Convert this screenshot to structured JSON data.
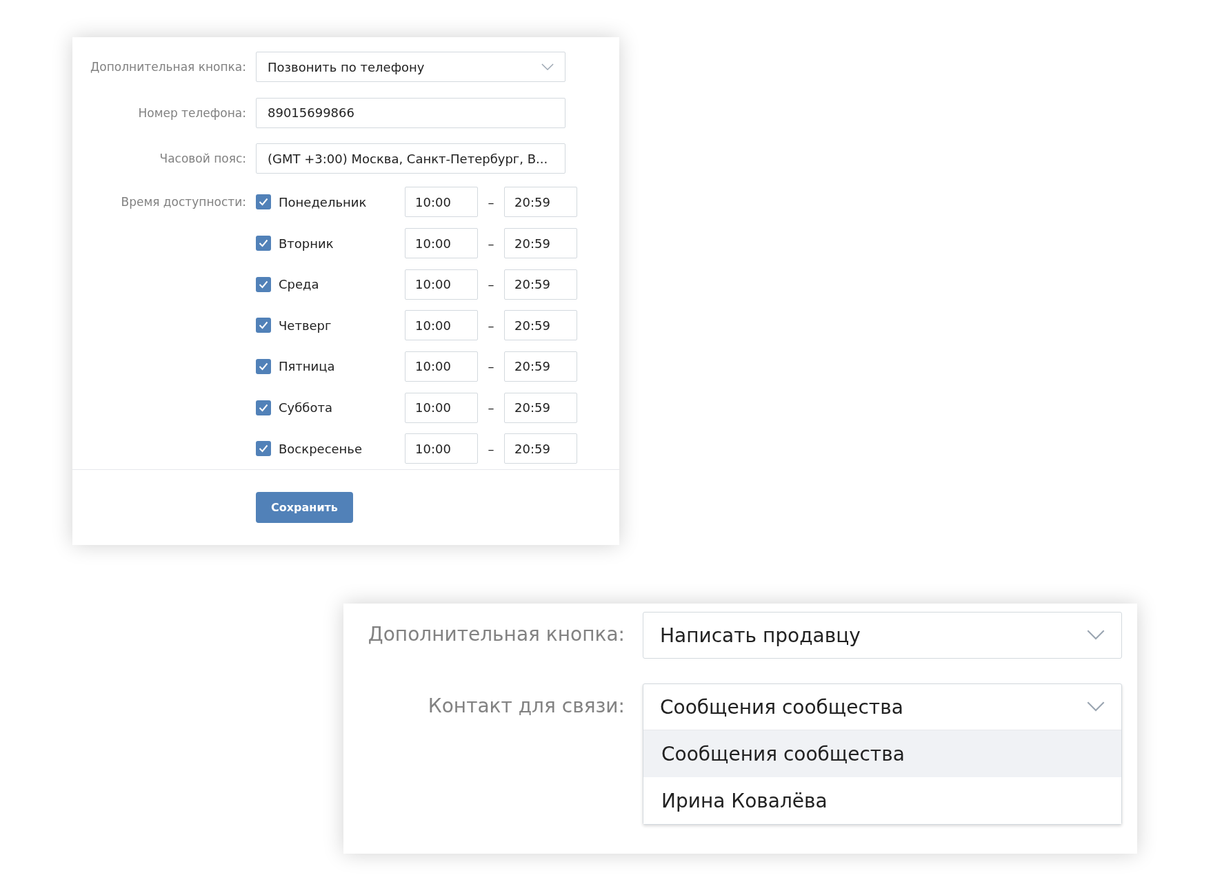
{
  "settings_card": {
    "fields": [
      {
        "kind": "select",
        "label": "Дополнительная кнопка:",
        "value": "Позвонить по телефону"
      },
      {
        "kind": "text",
        "label": "Номер телефона:",
        "value": "89015699866"
      },
      {
        "kind": "select",
        "label": "Часовой пояс:",
        "value": "(GMT +3:00) Москва, Санкт-Петербург, В..."
      }
    ],
    "schedule": {
      "label": "Время доступности:",
      "days": [
        {
          "day": "Понедельник",
          "checked": true,
          "from": "10:00",
          "dash": "–",
          "to": "20:59"
        },
        {
          "day": "Вторник",
          "checked": true,
          "from": "10:00",
          "dash": "–",
          "to": "20:59"
        },
        {
          "day": "Среда",
          "checked": true,
          "from": "10:00",
          "dash": "–",
          "to": "20:59"
        },
        {
          "day": "Четверг",
          "checked": true,
          "from": "10:00",
          "dash": "–",
          "to": "20:59"
        },
        {
          "day": "Пятница",
          "checked": true,
          "from": "10:00",
          "dash": "–",
          "to": "20:59"
        },
        {
          "day": "Суббота",
          "checked": true,
          "from": "10:00",
          "dash": "–",
          "to": "20:59"
        },
        {
          "day": "Воскресенье",
          "checked": true,
          "from": "10:00",
          "dash": "–",
          "to": "20:59"
        }
      ]
    },
    "save_button": "Сохранить"
  },
  "contact_card": {
    "fields": [
      {
        "label": "Дополнительная кнопка:",
        "value": "Написать продавцу",
        "expanded": false
      },
      {
        "label": "Контакт для связи:",
        "value": "Сообщения сообщества",
        "expanded": true,
        "options": [
          {
            "label": "Сообщения сообщества",
            "selected": true
          },
          {
            "label": "Ирина Ковалёва",
            "selected": false
          }
        ]
      }
    ]
  }
}
